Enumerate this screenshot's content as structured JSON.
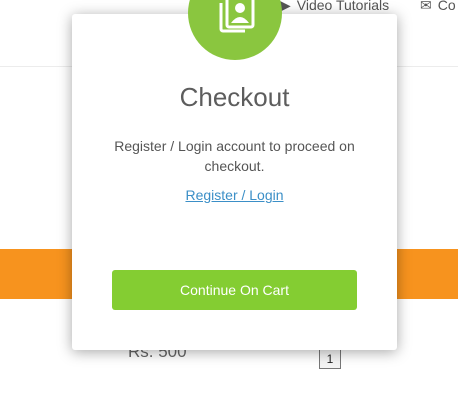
{
  "background": {
    "nav": {
      "video_label": "Video Tutorials",
      "contact_label": "Co"
    },
    "price": "Rs. 500",
    "quantity": "1"
  },
  "modal": {
    "icon": "user-card-icon",
    "title": "Checkout",
    "message": "Register / Login account to proceed on checkout.",
    "link_label": "Register / Login",
    "button_label": "Continue On Cart"
  },
  "colors": {
    "accent_green": "#84cd32",
    "icon_green": "#8ac63f",
    "orange_band": "#f7931e",
    "link_blue": "#3b8fc7"
  }
}
